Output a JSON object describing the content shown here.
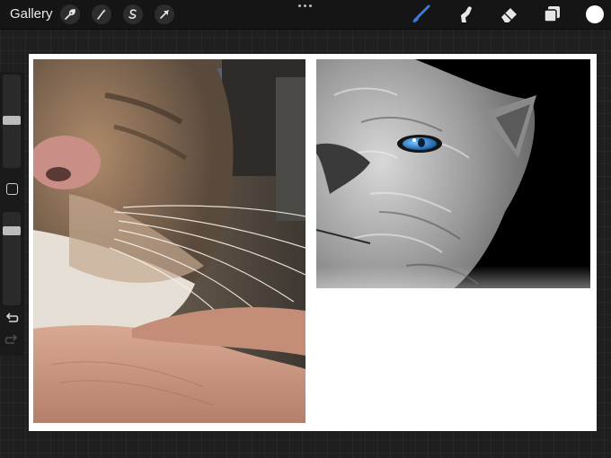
{
  "toolbar": {
    "gallery_label": "Gallery",
    "left_icons": [
      "wrench-icon",
      "magic-wand-icon",
      "selection-icon",
      "transform-arrow-icon"
    ],
    "more_icon": "ellipsis-icon",
    "right_tools": [
      "brush-icon",
      "smudge-icon",
      "eraser-icon",
      "layers-icon"
    ],
    "active_tool": "brush-icon",
    "color": "#ffffff",
    "accent": "#3a7bd5"
  },
  "sidebar": {
    "controls": [
      "brush-size-slider",
      "modify-button",
      "opacity-slider",
      "undo-icon",
      "redo-icon"
    ]
  },
  "canvas": {
    "background": "#ffffff",
    "content": [
      "cat-photo",
      "cat-painting"
    ]
  }
}
